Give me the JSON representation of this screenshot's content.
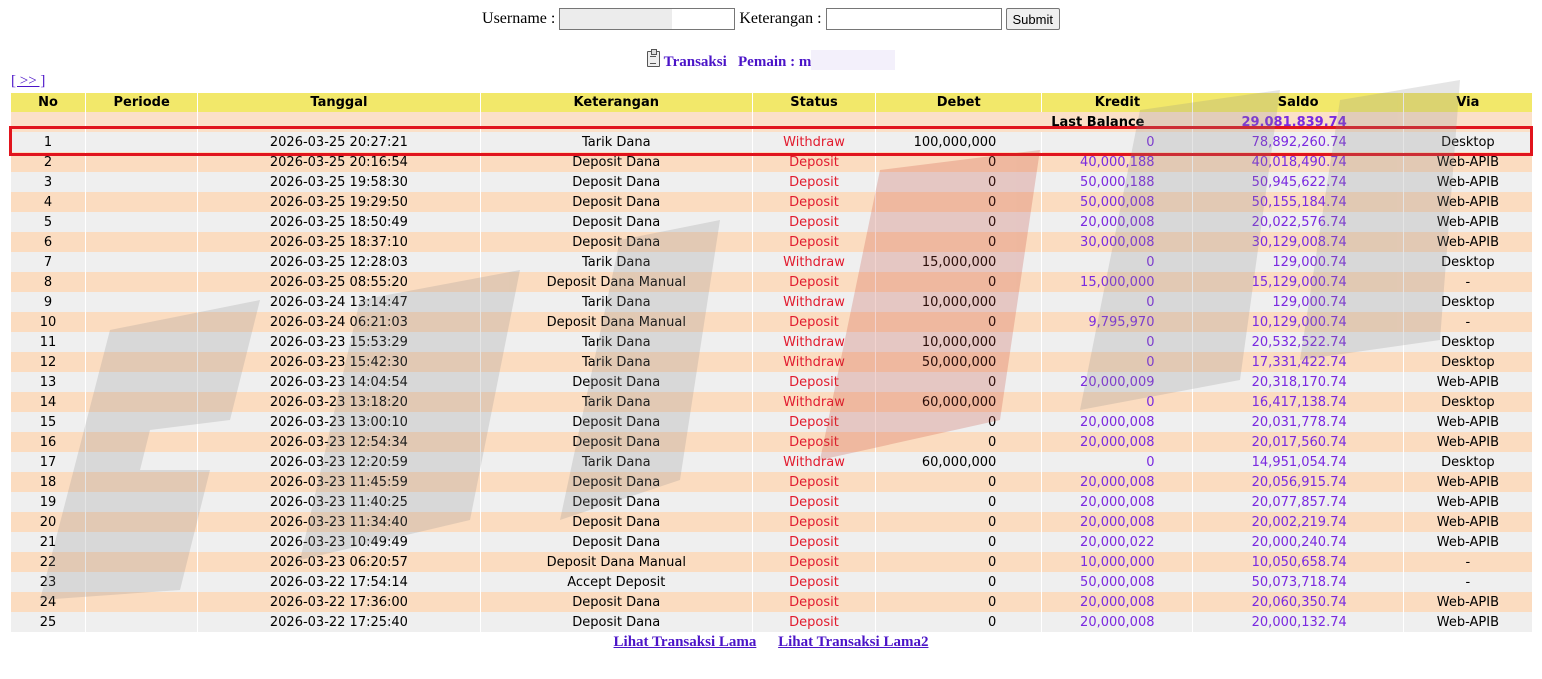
{
  "form": {
    "username_label": "Username :",
    "username_value": "",
    "keterangan_label": "Keterangan :",
    "keterangan_value": "",
    "submit_label": "Submit"
  },
  "heading": {
    "title": "Transaksi",
    "pemain_label": "Pemain : m"
  },
  "nav_next_label": "[ >> ]",
  "columns": [
    "No",
    "Periode",
    "Tanggal",
    "Keterangan",
    "Status",
    "Debet",
    "Kredit",
    "Saldo",
    "Via"
  ],
  "last_balance": {
    "label": "Last Balance",
    "saldo": "29,081,839.74"
  },
  "rows": [
    {
      "no": "1",
      "periode": "",
      "tanggal": "2026-03-25 20:27:21",
      "keterangan": "Tarik Dana",
      "status": "Withdraw",
      "debet": "100,000,000",
      "kredit": "0",
      "saldo": "78,892,260.74",
      "via": "Desktop"
    },
    {
      "no": "2",
      "periode": "",
      "tanggal": "2026-03-25 20:16:54",
      "keterangan": "Deposit Dana",
      "status": "Deposit",
      "debet": "0",
      "kredit": "40,000,188",
      "saldo": "40,018,490.74",
      "via": "Web-APIB"
    },
    {
      "no": "3",
      "periode": "",
      "tanggal": "2026-03-25 19:58:30",
      "keterangan": "Deposit Dana",
      "status": "Deposit",
      "debet": "0",
      "kredit": "50,000,188",
      "saldo": "50,945,622.74",
      "via": "Web-APIB"
    },
    {
      "no": "4",
      "periode": "",
      "tanggal": "2026-03-25 19:29:50",
      "keterangan": "Deposit Dana",
      "status": "Deposit",
      "debet": "0",
      "kredit": "50,000,008",
      "saldo": "50,155,184.74",
      "via": "Web-APIB"
    },
    {
      "no": "5",
      "periode": "",
      "tanggal": "2026-03-25 18:50:49",
      "keterangan": "Deposit Dana",
      "status": "Deposit",
      "debet": "0",
      "kredit": "20,000,008",
      "saldo": "20,022,576.74",
      "via": "Web-APIB"
    },
    {
      "no": "6",
      "periode": "",
      "tanggal": "2026-03-25 18:37:10",
      "keterangan": "Deposit Dana",
      "status": "Deposit",
      "debet": "0",
      "kredit": "30,000,008",
      "saldo": "30,129,008.74",
      "via": "Web-APIB"
    },
    {
      "no": "7",
      "periode": "",
      "tanggal": "2026-03-25 12:28:03",
      "keterangan": "Tarik Dana",
      "status": "Withdraw",
      "debet": "15,000,000",
      "kredit": "0",
      "saldo": "129,000.74",
      "via": "Desktop"
    },
    {
      "no": "8",
      "periode": "",
      "tanggal": "2026-03-25 08:55:20",
      "keterangan": "Deposit Dana Manual",
      "status": "Deposit",
      "debet": "0",
      "kredit": "15,000,000",
      "saldo": "15,129,000.74",
      "via": "-"
    },
    {
      "no": "9",
      "periode": "",
      "tanggal": "2026-03-24 13:14:47",
      "keterangan": "Tarik Dana",
      "status": "Withdraw",
      "debet": "10,000,000",
      "kredit": "0",
      "saldo": "129,000.74",
      "via": "Desktop"
    },
    {
      "no": "10",
      "periode": "",
      "tanggal": "2026-03-24 06:21:03",
      "keterangan": "Deposit Dana Manual",
      "status": "Deposit",
      "debet": "0",
      "kredit": "9,795,970",
      "saldo": "10,129,000.74",
      "via": "-"
    },
    {
      "no": "11",
      "periode": "",
      "tanggal": "2026-03-23 15:53:29",
      "keterangan": "Tarik Dana",
      "status": "Withdraw",
      "debet": "10,000,000",
      "kredit": "0",
      "saldo": "20,532,522.74",
      "via": "Desktop"
    },
    {
      "no": "12",
      "periode": "",
      "tanggal": "2026-03-23 15:42:30",
      "keterangan": "Tarik Dana",
      "status": "Withdraw",
      "debet": "50,000,000",
      "kredit": "0",
      "saldo": "17,331,422.74",
      "via": "Desktop"
    },
    {
      "no": "13",
      "periode": "",
      "tanggal": "2026-03-23 14:04:54",
      "keterangan": "Deposit Dana",
      "status": "Deposit",
      "debet": "0",
      "kredit": "20,000,009",
      "saldo": "20,318,170.74",
      "via": "Web-APIB"
    },
    {
      "no": "14",
      "periode": "",
      "tanggal": "2026-03-23 13:18:20",
      "keterangan": "Tarik Dana",
      "status": "Withdraw",
      "debet": "60,000,000",
      "kredit": "0",
      "saldo": "16,417,138.74",
      "via": "Desktop"
    },
    {
      "no": "15",
      "periode": "",
      "tanggal": "2026-03-23 13:00:10",
      "keterangan": "Deposit Dana",
      "status": "Deposit",
      "debet": "0",
      "kredit": "20,000,008",
      "saldo": "20,031,778.74",
      "via": "Web-APIB"
    },
    {
      "no": "16",
      "periode": "",
      "tanggal": "2026-03-23 12:54:34",
      "keterangan": "Deposit Dana",
      "status": "Deposit",
      "debet": "0",
      "kredit": "20,000,008",
      "saldo": "20,017,560.74",
      "via": "Web-APIB"
    },
    {
      "no": "17",
      "periode": "",
      "tanggal": "2026-03-23 12:20:59",
      "keterangan": "Tarik Dana",
      "status": "Withdraw",
      "debet": "60,000,000",
      "kredit": "0",
      "saldo": "14,951,054.74",
      "via": "Desktop"
    },
    {
      "no": "18",
      "periode": "",
      "tanggal": "2026-03-23 11:45:59",
      "keterangan": "Deposit Dana",
      "status": "Deposit",
      "debet": "0",
      "kredit": "20,000,008",
      "saldo": "20,056,915.74",
      "via": "Web-APIB"
    },
    {
      "no": "19",
      "periode": "",
      "tanggal": "2026-03-23 11:40:25",
      "keterangan": "Deposit Dana",
      "status": "Deposit",
      "debet": "0",
      "kredit": "20,000,008",
      "saldo": "20,077,857.74",
      "via": "Web-APIB"
    },
    {
      "no": "20",
      "periode": "",
      "tanggal": "2026-03-23 11:34:40",
      "keterangan": "Deposit Dana",
      "status": "Deposit",
      "debet": "0",
      "kredit": "20,000,008",
      "saldo": "20,002,219.74",
      "via": "Web-APIB"
    },
    {
      "no": "21",
      "periode": "",
      "tanggal": "2026-03-23 10:49:49",
      "keterangan": "Deposit Dana",
      "status": "Deposit",
      "debet": "0",
      "kredit": "20,000,022",
      "saldo": "20,000,240.74",
      "via": "Web-APIB"
    },
    {
      "no": "22",
      "periode": "",
      "tanggal": "2026-03-23 06:20:57",
      "keterangan": "Deposit Dana Manual",
      "status": "Deposit",
      "debet": "0",
      "kredit": "10,000,000",
      "saldo": "10,050,658.74",
      "via": "-"
    },
    {
      "no": "23",
      "periode": "",
      "tanggal": "2026-03-22 17:54:14",
      "keterangan": "Accept Deposit",
      "status": "Deposit",
      "debet": "0",
      "kredit": "50,000,008",
      "saldo": "50,073,718.74",
      "via": "-"
    },
    {
      "no": "24",
      "periode": "",
      "tanggal": "2026-03-22 17:36:00",
      "keterangan": "Deposit Dana",
      "status": "Deposit",
      "debet": "0",
      "kredit": "20,000,008",
      "saldo": "20,060,350.74",
      "via": "Web-APIB"
    },
    {
      "no": "25",
      "periode": "",
      "tanggal": "2026-03-22 17:25:40",
      "keterangan": "Deposit Dana",
      "status": "Deposit",
      "debet": "0",
      "kredit": "20,000,008",
      "saldo": "20,000,132.74",
      "via": "Web-APIB"
    }
  ],
  "bottom_links": [
    "Lihat Transaksi Lama",
    "Lihat Transaksi Lama2"
  ],
  "colors": {
    "header_bg": "#f2e86a",
    "row_odd": "#efefef",
    "row_even": "#fbdcc0",
    "status_red": "#e21b2e",
    "purple": "#7a2ae0",
    "highlight": "#e1141d"
  },
  "icons": [
    "clipboard-icon"
  ]
}
